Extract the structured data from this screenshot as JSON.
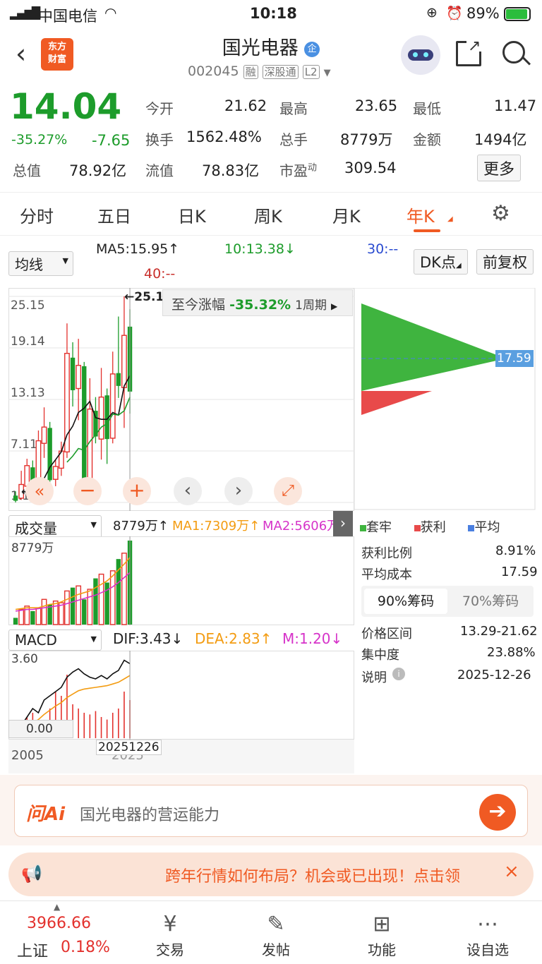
{
  "status_bar": {
    "carrier": "中国电信",
    "time": "10:18",
    "battery": "89%"
  },
  "header": {
    "stock_name": "国光电器",
    "badge": "企",
    "code": "002045",
    "tags": [
      "融",
      "深股通",
      "L2"
    ],
    "logo_line1": "东方",
    "logo_line2": "财富"
  },
  "quote": {
    "price": "14.04",
    "change_pct": "-35.27%",
    "change": "-7.65",
    "rows": [
      [
        {
          "label": "今开",
          "value": "21.62",
          "color": "#1d9c2b"
        },
        {
          "label": "最高",
          "value": "23.65",
          "color": "#e3312d"
        },
        {
          "label": "最低",
          "value": "11.47",
          "color": "#1d9c2b"
        }
      ],
      [
        {
          "label": "换手",
          "value": "1562.48%",
          "color": "#222"
        },
        {
          "label": "总手",
          "value": "8779万",
          "color": "#222"
        },
        {
          "label": "金额",
          "value": "1494亿",
          "color": "#222"
        }
      ],
      [
        {
          "label": "流值",
          "value": "78.83亿",
          "color": "#222"
        },
        {
          "label": "市盈",
          "sup": "动",
          "value": "309.54",
          "color": "#222"
        }
      ]
    ],
    "total_value_label": "总值",
    "total_value": "78.92亿",
    "more_button": "更多"
  },
  "tabs": [
    "分时",
    "五日",
    "日K",
    "周K",
    "月K",
    "年K"
  ],
  "active_tab": "年K",
  "ma_bar": {
    "select": "均线",
    "ma5": "MA5:15.95↑",
    "ma10": "10:13.38↓",
    "ma30": "30:--",
    "ma40": "40:--",
    "dk_button": "DK点",
    "adjust_button": "前复权"
  },
  "chart_data": {
    "type": "candlestick",
    "y_ticks": [
      "25.15",
      "19.14",
      "13.13",
      "7.11",
      "1.10"
    ],
    "high_marker": "25.1",
    "low_marker": "10",
    "x_labels": [
      "2005",
      "2025"
    ],
    "cursor_date": "20251226",
    "change_banner": {
      "label": "至今涨幅",
      "value": "-35.32%",
      "period": "1周期"
    },
    "candles": [
      {
        "o": 1.9,
        "c": 1.3,
        "h": 2.4,
        "l": 1.1,
        "up": false
      },
      {
        "o": 1.6,
        "c": 3.2,
        "h": 4.8,
        "l": 1.4,
        "up": true
      },
      {
        "o": 3.0,
        "c": 5.4,
        "h": 6.2,
        "l": 2.6,
        "up": true
      },
      {
        "o": 5.2,
        "c": 2.6,
        "h": 6.0,
        "l": 2.2,
        "up": false
      },
      {
        "o": 2.8,
        "c": 8.3,
        "h": 9.5,
        "l": 2.5,
        "up": true
      },
      {
        "o": 8.0,
        "c": 9.9,
        "h": 12.2,
        "l": 6.3,
        "up": true
      },
      {
        "o": 9.8,
        "c": 3.7,
        "h": 10.5,
        "l": 3.2,
        "up": false
      },
      {
        "o": 3.8,
        "c": 5.3,
        "h": 6.1,
        "l": 3.0,
        "up": true
      },
      {
        "o": 5.1,
        "c": 7.1,
        "h": 8.2,
        "l": 4.2,
        "up": true
      },
      {
        "o": 7.0,
        "c": 18.5,
        "h": 22.0,
        "l": 6.3,
        "up": true
      },
      {
        "o": 18.0,
        "c": 14.2,
        "h": 19.8,
        "l": 12.3,
        "up": false
      },
      {
        "o": 14.4,
        "c": 17.1,
        "h": 20.2,
        "l": 10.7,
        "up": true
      },
      {
        "o": 17.0,
        "c": 3.6,
        "h": 17.5,
        "l": 2.7,
        "up": false
      },
      {
        "o": 3.8,
        "c": 12.0,
        "h": 15.6,
        "l": 2.8,
        "up": true
      },
      {
        "o": 11.8,
        "c": 8.8,
        "h": 13.4,
        "l": 8.0,
        "up": false
      },
      {
        "o": 8.5,
        "c": 13.4,
        "h": 16.8,
        "l": 6.1,
        "up": true
      },
      {
        "o": 13.6,
        "c": 8.5,
        "h": 14.4,
        "l": 5.6,
        "up": false
      },
      {
        "o": 8.6,
        "c": 16.1,
        "h": 18.7,
        "l": 8.0,
        "up": true
      },
      {
        "o": 16.2,
        "c": 14.7,
        "h": 22.8,
        "l": 13.3,
        "up": false
      },
      {
        "o": 14.5,
        "c": 20.6,
        "h": 25.15,
        "l": 9.8,
        "up": true
      },
      {
        "o": 21.62,
        "c": 14.04,
        "h": 23.65,
        "l": 11.47,
        "up": false
      }
    ],
    "ma5": [
      null,
      null,
      null,
      null,
      2.7,
      3.9,
      5.2,
      6.1,
      7.0,
      9.0,
      10.0,
      11.6,
      12.1,
      12.9,
      11.0,
      10.8,
      10.8,
      11.6,
      11.3,
      14.7,
      15.9
    ],
    "ma10": [
      null,
      null,
      null,
      null,
      null,
      null,
      null,
      null,
      null,
      5.8,
      6.5,
      7.4,
      7.2,
      8.2,
      9.0,
      9.9,
      10.3,
      11.4,
      11.3,
      11.8,
      13.4
    ]
  },
  "chip": {
    "avg_cost_marker": "17.59",
    "legend": [
      "套牢",
      "获利",
      "平均"
    ],
    "profit_ratio_label": "获利比例",
    "profit_ratio": "8.91%",
    "avg_cost_label": "平均成本",
    "avg_cost": "17.59",
    "tab_90": "90%筹码",
    "tab_70": "70%筹码",
    "range_label": "价格区间",
    "range": "13.29-21.62",
    "concentration_label": "集中度",
    "concentration": "23.88%",
    "note_label": "说明",
    "note_date": "2025-12-26"
  },
  "volume": {
    "select": "成交量",
    "current": "8779万↑",
    "ma1": "MA1:7309万↑",
    "ma2": "MA2:5606万↑",
    "axis_label": "8779万",
    "bars": [
      0.08,
      0.18,
      0.22,
      0.16,
      0.2,
      0.3,
      0.24,
      0.28,
      0.26,
      0.4,
      0.44,
      0.46,
      0.3,
      0.42,
      0.55,
      0.6,
      0.5,
      0.64,
      0.78,
      0.85,
      1.0
    ],
    "ma1_line": [
      0.18,
      0.19,
      0.2,
      0.2,
      0.2,
      0.22,
      0.24,
      0.25,
      0.27,
      0.3,
      0.33,
      0.36,
      0.38,
      0.4,
      0.44,
      0.48,
      0.52,
      0.58,
      0.65,
      0.72,
      0.8
    ],
    "ma2_line": [
      0.16,
      0.17,
      0.18,
      0.18,
      0.19,
      0.2,
      0.21,
      0.22,
      0.23,
      0.25,
      0.27,
      0.29,
      0.31,
      0.33,
      0.35,
      0.38,
      0.41,
      0.45,
      0.5,
      0.56,
      0.62
    ]
  },
  "macd": {
    "select": "MACD",
    "dif": "DIF:3.43↓",
    "dea": "DEA:2.83↑",
    "m": "M:1.20↓",
    "top_label": "3.60",
    "zero_label": "0.00",
    "bars": [
      0.0,
      0.1,
      0.25,
      0.3,
      0.15,
      0.2,
      0.35,
      0.55,
      0.5,
      0.75,
      0.4,
      0.35,
      0.3,
      0.28,
      0.32,
      0.25,
      0.22,
      0.3,
      0.35,
      0.55,
      0.45
    ],
    "dif_line": [
      0.1,
      0.15,
      0.25,
      0.35,
      0.3,
      0.45,
      0.5,
      0.55,
      0.6,
      0.72,
      0.78,
      0.82,
      0.76,
      0.72,
      0.7,
      0.74,
      0.7,
      0.76,
      0.8,
      0.92,
      0.88
    ],
    "dea_line": [
      0.05,
      0.08,
      0.12,
      0.18,
      0.22,
      0.28,
      0.33,
      0.38,
      0.42,
      0.48,
      0.52,
      0.56,
      0.58,
      0.59,
      0.6,
      0.61,
      0.62,
      0.64,
      0.66,
      0.7,
      0.74
    ]
  },
  "ai_bar": {
    "logo": "问Ai",
    "text": "国光电器的营运能力"
  },
  "promo": {
    "text": "跨年行情如何布局？机会或已出现！点击领"
  },
  "bottom": {
    "index_value": "3966.66",
    "index_name": "上证",
    "index_change": "0.18%",
    "items": [
      "交易",
      "发帖",
      "功能",
      "设自选"
    ]
  }
}
